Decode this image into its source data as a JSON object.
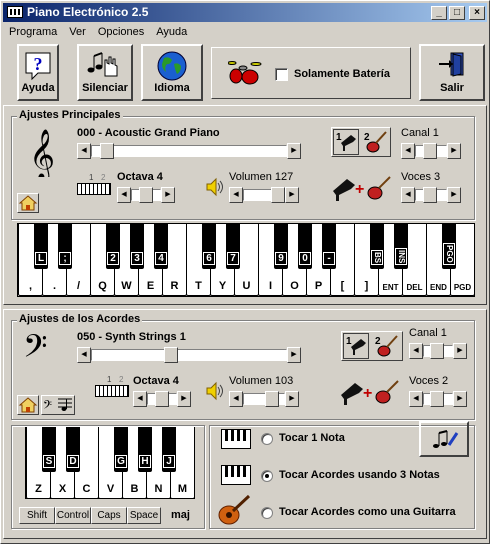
{
  "window": {
    "title": "Piano Electrónico 2.5"
  },
  "menu": [
    "Programa",
    "Ver",
    "Opciones",
    "Ayuda"
  ],
  "toolbar": {
    "help": "Ayuda",
    "mute": "Silenciar",
    "language": "Idioma",
    "drums_only": "Solamente Batería",
    "exit": "Salir"
  },
  "main": {
    "title": "Ajustes Principales",
    "instrument": "000 - Acoustic Grand Piano",
    "instrument_level": 0.05,
    "octave_label": "Octava 4",
    "octave_level": 0.5,
    "volume_label": "Volumen 127",
    "volume_level": 1.0,
    "channel_label": "Canal 1",
    "channel_level": 0.45,
    "voices_label": "Voces 3",
    "voices_level": 0.45,
    "white_keys": [
      ",",
      ".",
      "/",
      "Q",
      "W",
      "E",
      "R",
      "T",
      "Y",
      "U",
      "I",
      "O",
      "P",
      "[",
      "]",
      "ENT",
      "DEL",
      "END",
      "PGD"
    ],
    "black_keys": [
      "L",
      ";",
      "2",
      "3",
      "4",
      "6",
      "7",
      "9",
      "0",
      "-",
      "BS",
      "INS",
      "PGO"
    ]
  },
  "chords": {
    "title": "Ajustes de los Acordes",
    "instrument": "050 - Synth Strings 1",
    "instrument_level": 0.4,
    "octave_label": "Octava 4",
    "octave_level": 0.5,
    "volume_label": "Volumen 103",
    "volume_level": 0.8,
    "channel_label": "Canal 1",
    "channel_level": 0.45,
    "voices_label": "Voces 2",
    "voices_level": 0.45,
    "white_keys": [
      "Z",
      "X",
      "C",
      "V",
      "B",
      "N",
      "M"
    ],
    "black_keys": [
      "S",
      "D",
      "G",
      "H",
      "J"
    ],
    "modifiers": [
      "Shift",
      "Control",
      "Caps",
      "Space"
    ],
    "mode": "maj",
    "opt1": "Tocar 1 Nota",
    "opt2": "Tocar Acordes usando 3 Notas",
    "opt3": "Tocar Acordes como una Guitarra",
    "selected": 2
  },
  "octave_ticks": [
    "1",
    "2"
  ]
}
